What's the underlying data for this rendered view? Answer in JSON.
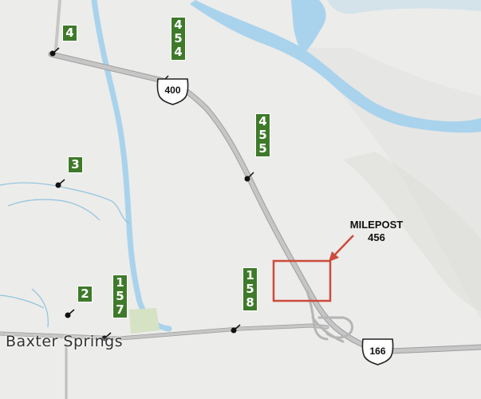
{
  "colors": {
    "land": "#ececea",
    "water": "#a9d3ec",
    "stream": "#8fc4dc",
    "road": "#bdbdbd",
    "milepost_bg": "#3e7a2a",
    "highlight": "#cc4b3c"
  },
  "callout": {
    "line1": "MILEPOST",
    "line2": "456"
  },
  "place_label": "Baxter Springs",
  "shields": [
    {
      "id": "us-400",
      "number": "400"
    },
    {
      "id": "us-166",
      "number": "166"
    }
  ],
  "mileposts": [
    {
      "id": "mp-4",
      "digits": "4"
    },
    {
      "id": "mp-454",
      "digits": [
        "4",
        "5",
        "4"
      ]
    },
    {
      "id": "mp-455",
      "digits": [
        "4",
        "5",
        "5"
      ]
    },
    {
      "id": "mp-3",
      "digits": "3"
    },
    {
      "id": "mp-2",
      "digits": "2"
    },
    {
      "id": "mp-157",
      "digits": [
        "1",
        "5",
        "7"
      ]
    },
    {
      "id": "mp-158",
      "digits": [
        "1",
        "5",
        "8"
      ]
    }
  ]
}
